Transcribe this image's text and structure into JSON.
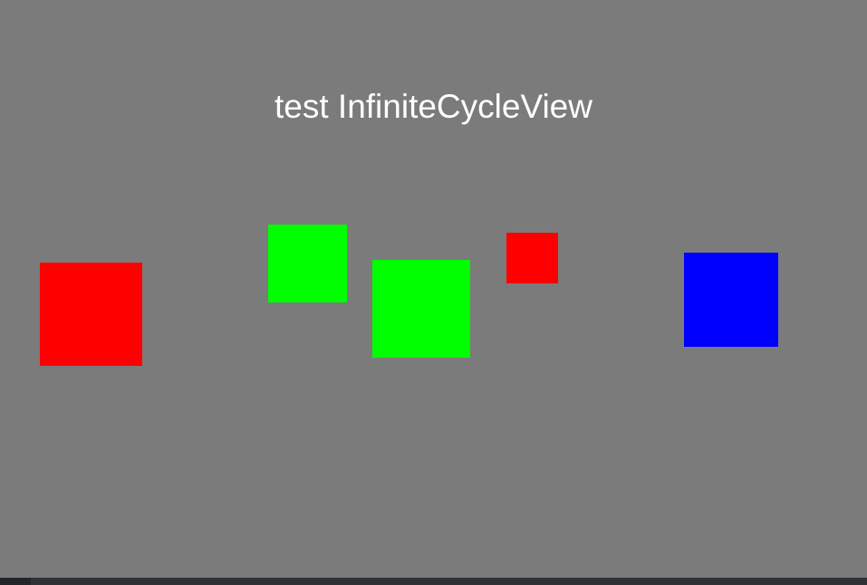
{
  "window": {
    "title": "test InfiniteCycleView",
    "background_color": "#7b7b7b"
  },
  "cycle_view": {
    "items": [
      {
        "name": "red-square",
        "color": "#ff0000"
      },
      {
        "name": "green-square",
        "color": "#00ff00"
      },
      {
        "name": "green-square",
        "color": "#00ff00"
      },
      {
        "name": "red-square",
        "color": "#ff0000"
      },
      {
        "name": "blue-square",
        "color": "#0000ff"
      }
    ]
  }
}
